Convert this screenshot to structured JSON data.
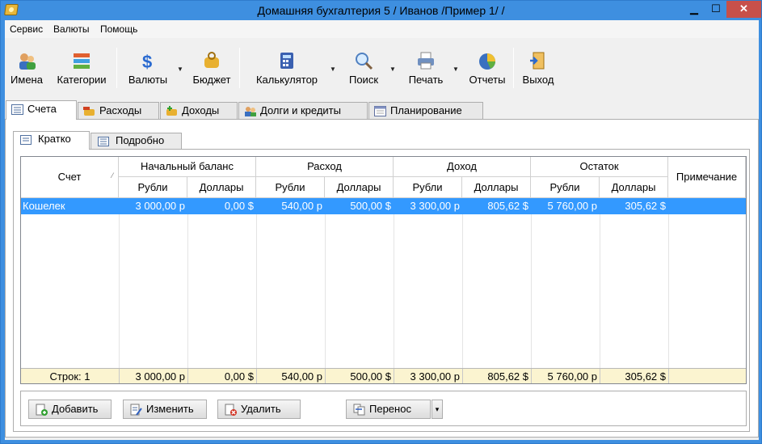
{
  "window": {
    "title": "Домашняя бухгалтерия 5  / Иванов /Пример 1/ /",
    "minimize": "▁",
    "maximize": "☐",
    "close": "✕"
  },
  "menu": [
    "Сервис",
    "Валюты",
    "Помощь"
  ],
  "toolbar": {
    "names": "Имена",
    "categories": "Категории",
    "currencies": "Валюты",
    "budget": "Бюджет",
    "calculator": "Калькулятор",
    "search": "Поиск",
    "print": "Печать",
    "reports": "Отчеты",
    "exit": "Выход"
  },
  "tabs": [
    "Счета",
    "Расходы",
    "Доходы",
    "Долги и кредиты",
    "Планирование"
  ],
  "subtabs": [
    "Кратко",
    "Подробно"
  ],
  "table": {
    "col_account": "Счет",
    "groups": [
      "Начальный баланс",
      "Расход",
      "Доход",
      "Остаток"
    ],
    "sub": {
      "rub": "Рубли",
      "usd": "Доллары"
    },
    "col_note": "Примечание",
    "rows": [
      {
        "name": "Кошелек",
        "values": [
          "3 000,00 р",
          "0,00 $",
          "540,00 р",
          "500,00 $",
          "3 300,00 р",
          "805,62 $",
          "5 760,00 р",
          "305,62 $"
        ],
        "note": ""
      }
    ],
    "footer": {
      "label": "Строк: 1",
      "values": [
        "3 000,00 р",
        "0,00 $",
        "540,00 р",
        "500,00 $",
        "3 300,00 р",
        "805,62 $",
        "5 760,00 р",
        "305,62 $"
      ]
    }
  },
  "buttons": {
    "add": "Добавить",
    "edit": "Изменить",
    "delete": "Удалить",
    "transfer": "Перенос",
    "dropdown": "▾"
  },
  "colors": {
    "titlebar": "#3e8fe0",
    "selection": "#3399ff",
    "footer": "#fbf4d0"
  }
}
